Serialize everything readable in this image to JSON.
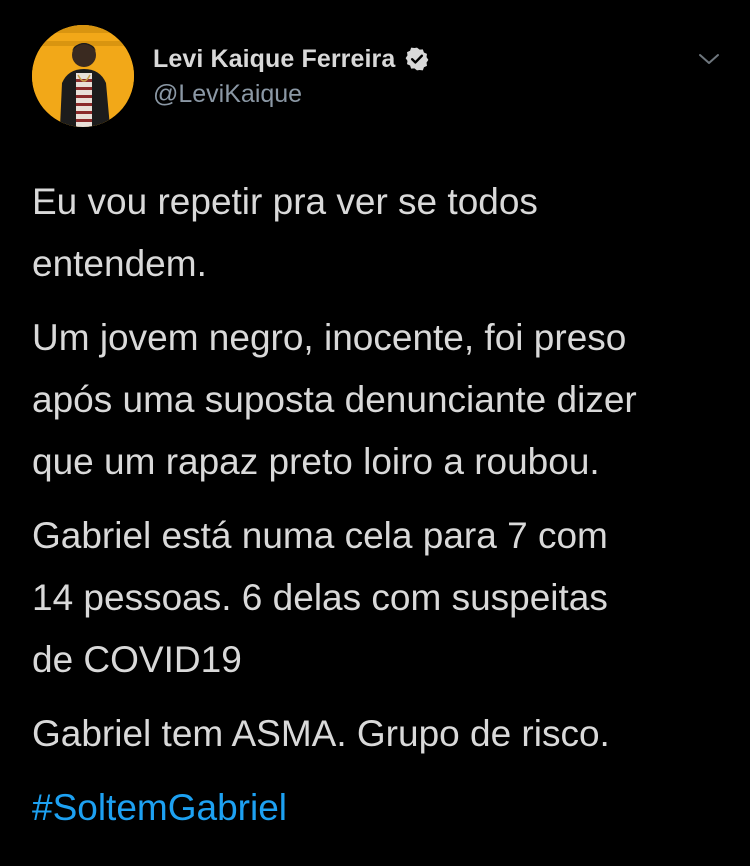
{
  "author": {
    "display_name": "Levi Kaique Ferreira",
    "handle": "@LeviKaique",
    "verified": true,
    "avatar_icon": "profile-photo",
    "more_icon": "chevron-down-icon"
  },
  "tweet": {
    "paragraphs": [
      "Eu vou repetir pra ver se todos\nentendem.",
      "Um jovem negro, inocente, foi preso\napós uma suposta denunciante dizer\nque um rapaz preto loiro a roubou.",
      "Gabriel está numa cela para 7 com\n14 pessoas. 6 delas com suspeitas\nde COVID19",
      "Gabriel tem ASMA. Grupo de risco."
    ],
    "hashtag": "#SoltemGabriel"
  },
  "colors": {
    "background": "#000000",
    "text": "#d9d9d9",
    "secondary_text": "#8b98a5",
    "link": "#1da1f2",
    "avatar_bg": "#f2a818"
  }
}
